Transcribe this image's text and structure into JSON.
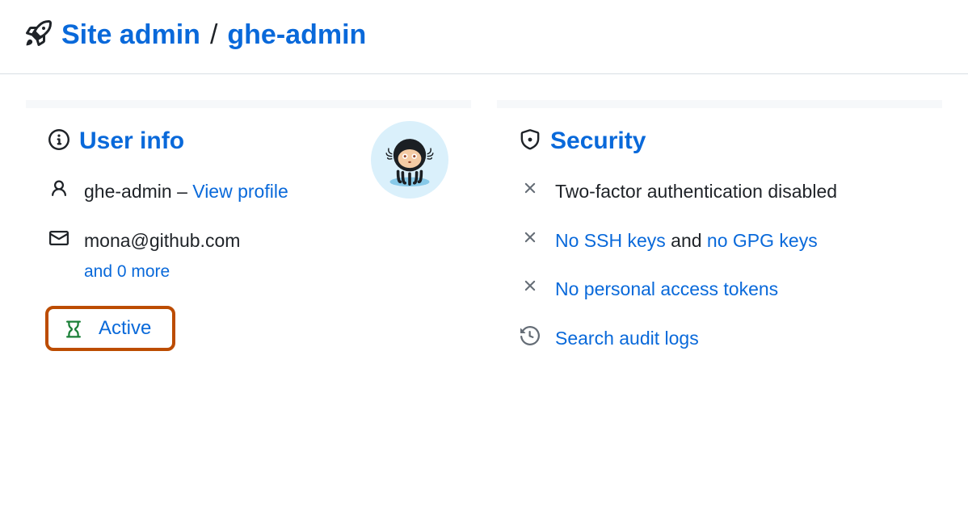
{
  "breadcrumb": {
    "site_admin": "Site admin",
    "separator": "/",
    "username": "ghe-admin"
  },
  "user_info": {
    "title": "User info",
    "username": "ghe-admin",
    "dash": " – ",
    "view_profile": "View profile",
    "email": "mona@github.com",
    "more_emails": "and 0 more",
    "active": "Active"
  },
  "security": {
    "title": "Security",
    "two_factor": "Two-factor authentication disabled",
    "no_ssh": "No SSH keys",
    "and": " and ",
    "no_gpg": "no GPG keys",
    "no_pat": "No personal access tokens",
    "search_audit": "Search audit logs"
  }
}
